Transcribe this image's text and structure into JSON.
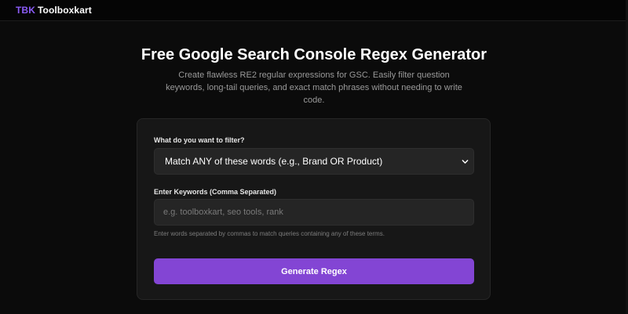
{
  "header": {
    "logo_mark": "TBK",
    "logo_text": "Toolboxkart"
  },
  "hero": {
    "title": "Free Google Search Console Regex Generator",
    "subtitle": "Create flawless RE2 regular expressions for GSC. Easily filter question keywords, long-tail queries, and exact match phrases without needing to write code."
  },
  "form": {
    "filter_label": "What do you want to filter?",
    "filter_selected": "Match ANY of these words (e.g., Brand OR Product)",
    "keywords_label": "Enter Keywords (Comma Separated)",
    "keywords_value": "",
    "keywords_placeholder": "e.g. toolboxkart, seo tools, rank",
    "keywords_help": "Enter words separated by commas to match queries containing any of these terms.",
    "generate_label": "Generate Regex"
  },
  "icons": {
    "select_arrow": "chevron-down-icon"
  },
  "colors": {
    "accent": "#8b5cf6",
    "button": "#8345d4",
    "background": "#0b0b0b",
    "card": "#171717",
    "field": "#252525"
  }
}
